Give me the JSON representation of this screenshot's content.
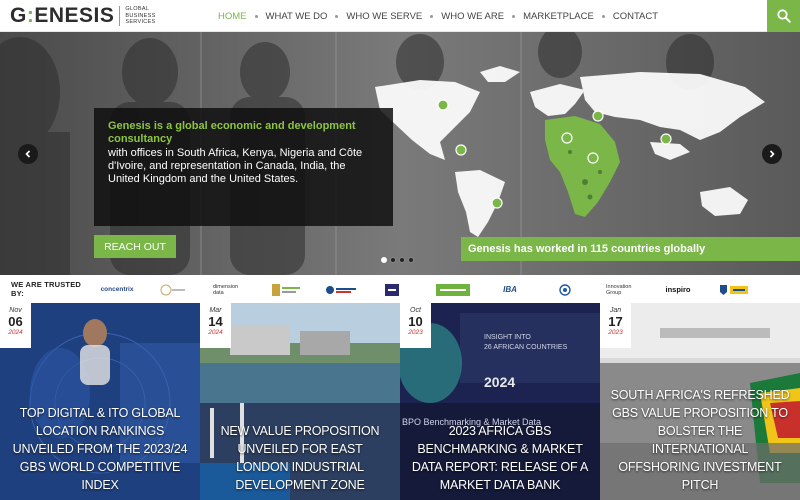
{
  "brand": {
    "logo_text": "G:ENESIS",
    "tagline_lines": [
      "GLOBAL",
      "BUSINESS",
      "SERVICES"
    ]
  },
  "nav": {
    "items": [
      "HOME",
      "WHAT WE DO",
      "WHO WE SERVE",
      "WHO WE ARE",
      "MARKETPLACE",
      "CONTACT"
    ],
    "active": "HOME"
  },
  "search": {
    "icon": "search-icon"
  },
  "hero": {
    "headline": "Genesis is a global economic and development consultancy",
    "body": "with offices in South Africa, Kenya, Nigeria and Côte d'Ivoire, and representation in Canada, India, the United Kingdom and the United States.",
    "cta": "REACH OUT",
    "countries_text": "Genesis has worked in 115 countries globally",
    "slide_count": 4,
    "active_slide": 1
  },
  "trusted": {
    "label": "WE ARE TRUSTED BY:",
    "clients": [
      "concentrix",
      "",
      "dimension data",
      "",
      "",
      "",
      "",
      "IBA",
      "",
      "Innovation Group",
      "inspiro",
      ""
    ]
  },
  "cards": [
    {
      "month": "Nov",
      "day": "06",
      "year": "2024",
      "title": "TOP DIGITAL & ITO GLOBAL LOCATION RANKINGS UNVEILED FROM THE 2023/24 GBS WORLD COMPETITIVE INDEX"
    },
    {
      "month": "Mar",
      "day": "14",
      "year": "2024",
      "title": "NEW VALUE PROPOSITION UNVEILED FOR EAST LONDON INDUSTRIAL DEVELOPMENT ZONE"
    },
    {
      "month": "Oct",
      "day": "10",
      "year": "2023",
      "title": "2023 AFRICA GBS BENCHMARKING & MARKET DATA REPORT: RELEASE OF A MARKET DATA BANK"
    },
    {
      "month": "Jan",
      "day": "17",
      "year": "2023",
      "title": "SOUTH AFRICA'S REFRESHED GBS VALUE PROPOSITION TO BOLSTER THE INTERNATIONAL OFFSHORING INVESTMENT PITCH"
    }
  ],
  "card_backgrounds": {
    "card3_heading": "INSIGHT INTO 26 AFRICAN COUNTRIES",
    "card3_year": "2024",
    "card3_banner": "BPO Benchmarking & Market Data"
  },
  "colors": {
    "brand_green": "#7ab648",
    "headline_green": "#8cc63f",
    "dark_panel": "#0f0f0f"
  }
}
